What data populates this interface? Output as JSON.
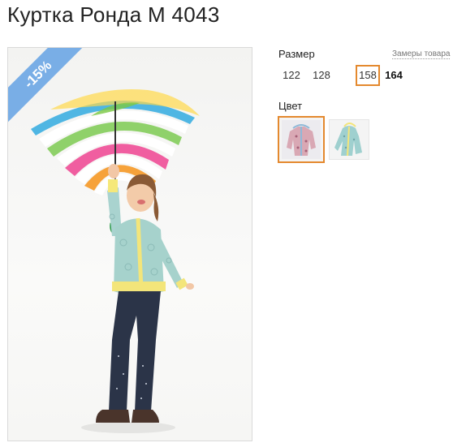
{
  "product": {
    "title": "Куртка Ронда М 4043",
    "discount_badge": "-15%"
  },
  "size": {
    "label": "Размер",
    "measure_link": "Замеры товара",
    "options": [
      "122",
      "128",
      "158",
      "164"
    ],
    "selected": "158"
  },
  "color": {
    "label": "Цвет",
    "swatches": [
      "jacket-photo-front",
      "jacket-photo-side"
    ],
    "selected_index": 0
  },
  "colors": {
    "accent": "#e4892e",
    "badge": "#79aee6"
  }
}
